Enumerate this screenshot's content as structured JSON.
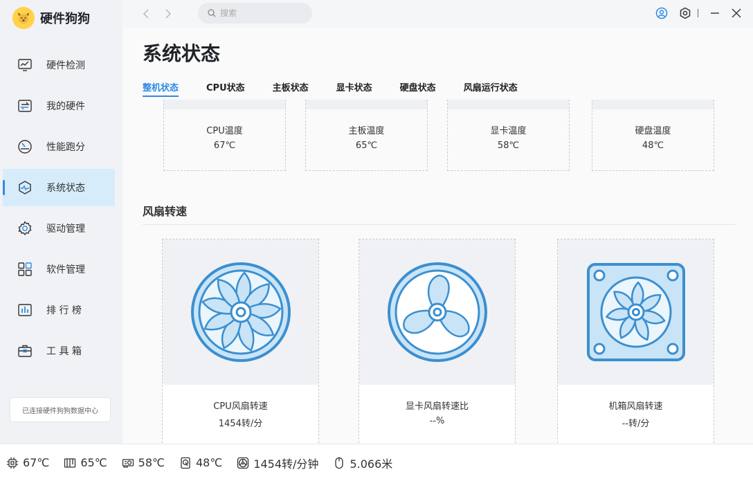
{
  "app": {
    "name": "硬件狗狗",
    "connection_status": "已连接硬件狗狗数据中心"
  },
  "sidebar": {
    "items": [
      {
        "label": "硬件检测",
        "icon": "monitor-icon"
      },
      {
        "label": "我的硬件",
        "icon": "swap-icon"
      },
      {
        "label": "性能跑分",
        "icon": "gauge-icon"
      },
      {
        "label": "系统状态",
        "icon": "pulse-icon",
        "active": true
      },
      {
        "label": "驱动管理",
        "icon": "gear-icon"
      },
      {
        "label": "软件管理",
        "icon": "apps-grid-icon"
      },
      {
        "label": "排 行 榜",
        "icon": "bar-chart-icon"
      },
      {
        "label": "工 具 箱",
        "icon": "toolbox-icon"
      }
    ]
  },
  "topbar": {
    "search_placeholder": "搜索"
  },
  "page": {
    "title": "系统状态",
    "tabs": [
      {
        "label": "整机状态",
        "active": true
      },
      {
        "label": "CPU状态"
      },
      {
        "label": "主板状态"
      },
      {
        "label": "显卡状态"
      },
      {
        "label": "硬盘状态"
      },
      {
        "label": "风扇运行状态"
      }
    ],
    "temps": [
      {
        "label": "CPU温度",
        "value": "67℃"
      },
      {
        "label": "主板温度",
        "value": "65℃"
      },
      {
        "label": "显卡温度",
        "value": "58℃"
      },
      {
        "label": "硬盘温度",
        "value": "48℃"
      }
    ],
    "fan_section_title": "风扇转速",
    "fans": [
      {
        "label": "CPU风扇转速",
        "value": "1454转/分"
      },
      {
        "label": "显卡风扇转速比",
        "value": "--%"
      },
      {
        "label": "机箱风扇转速",
        "value": "--转/分"
      }
    ]
  },
  "statusbar": {
    "cpu_temp": "67℃",
    "board_temp": "65℃",
    "gpu_temp": "58℃",
    "disk_temp": "48℃",
    "fan_speed": "1454转/分钟",
    "mouse_distance": "5.066米"
  },
  "colors": {
    "accent": "#2e8be6",
    "fan_fill": "#c9e4f7",
    "fan_stroke": "#3b8fd0"
  }
}
